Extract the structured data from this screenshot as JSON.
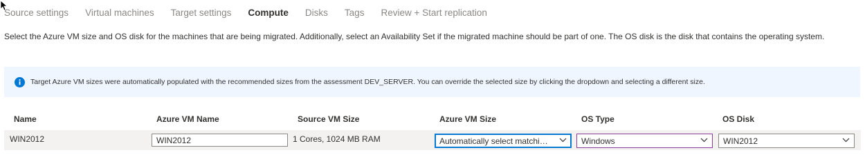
{
  "tabs": [
    {
      "label": "Source settings"
    },
    {
      "label": "Virtual machines"
    },
    {
      "label": "Target settings"
    },
    {
      "label": "Compute"
    },
    {
      "label": "Disks"
    },
    {
      "label": "Tags"
    },
    {
      "label": "Review + Start replication"
    }
  ],
  "active_tab": "Compute",
  "intro_text": "Select the Azure VM size and OS disk for the machines that are being migrated. Additionally, select an Availability Set if the migrated machine should be part of one. The OS disk is the disk that contains the operating system.",
  "info_banner": {
    "icon": "info-icon",
    "text": "Target Azure VM sizes were automatically populated with the recommended sizes from the assessment DEV_SERVER. You can override the selected size by clicking the dropdown and selecting a different size."
  },
  "table": {
    "columns": [
      "Name",
      "Azure VM Name",
      "Source VM Size",
      "Azure VM Size",
      "OS Type",
      "OS Disk"
    ],
    "rows": [
      {
        "name": "WIN2012",
        "azure_vm_name": "WIN2012",
        "source_vm_size": "1 Cores, 1024 MB RAM",
        "azure_vm_size": "Automatically select matching configuration",
        "os_type": "Windows",
        "os_disk": "WIN2012"
      }
    ]
  },
  "colors": {
    "accent": "#0078d4",
    "os_type_border": "#8a3b9a",
    "banner_bg": "#f0f6ff",
    "row_bg": "#f3f2f1"
  }
}
